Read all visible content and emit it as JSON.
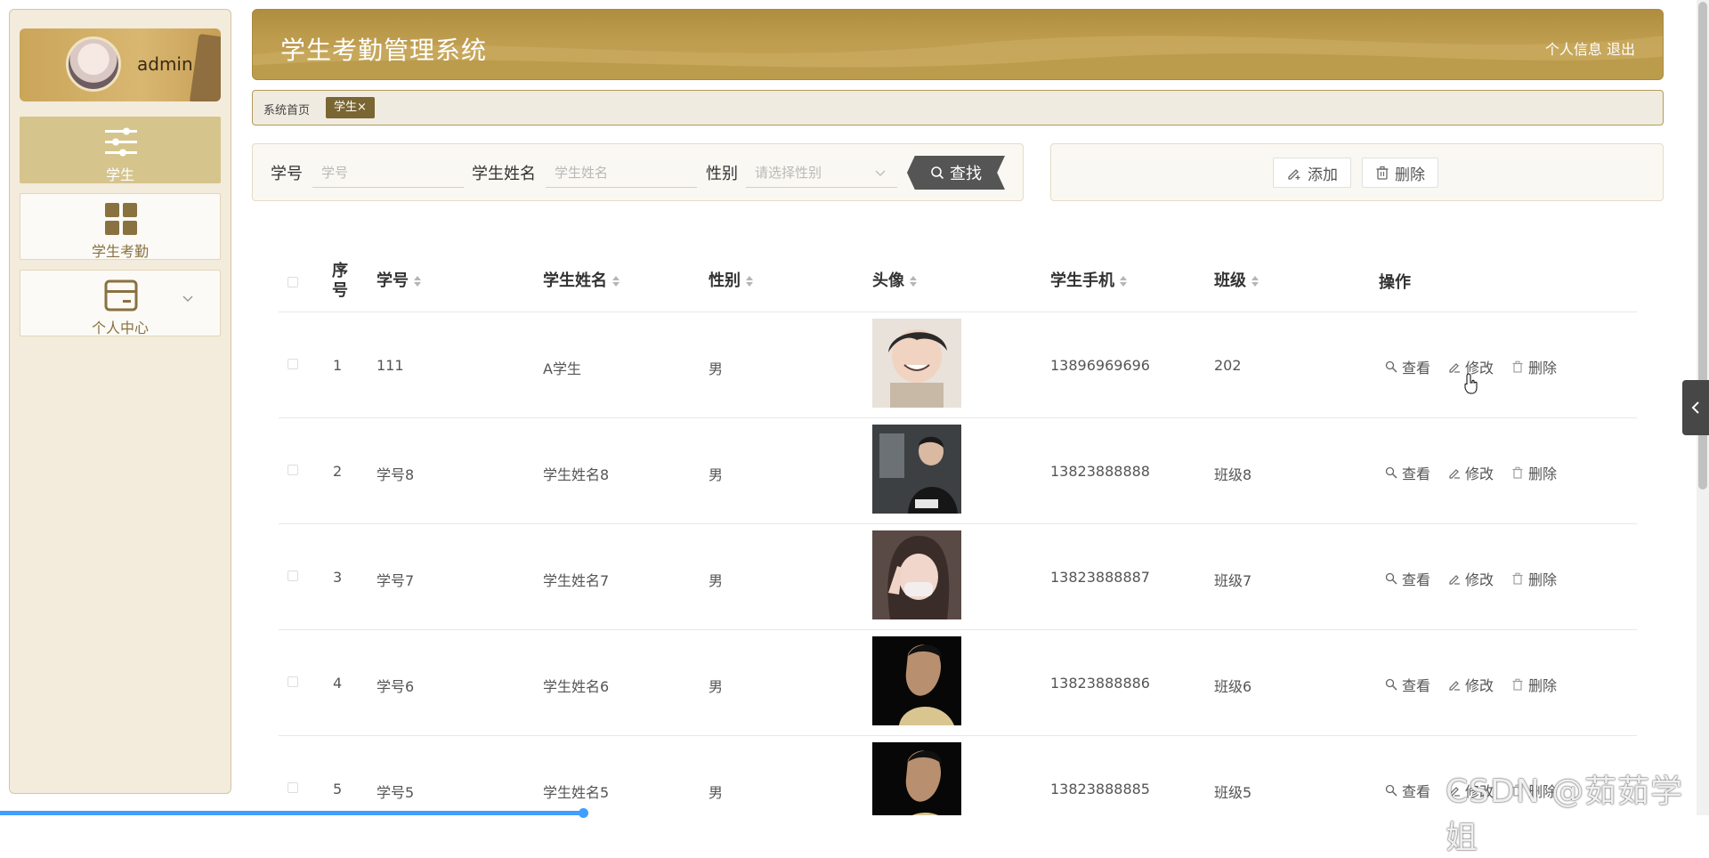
{
  "user": {
    "name": "admin"
  },
  "sidebar": {
    "items": [
      {
        "label": "学生",
        "icon": "sliders-icon",
        "active": true
      },
      {
        "label": "学生考勤",
        "icon": "grid-icon",
        "active": false
      },
      {
        "label": "个人中心",
        "icon": "card-icon",
        "active": false
      }
    ]
  },
  "header": {
    "title": "学生考勤管理系统",
    "links": {
      "profile": "个人信息",
      "logout": "退出"
    }
  },
  "breadcrumb": {
    "home": "系统首页",
    "tag": "学生×"
  },
  "search": {
    "student_id_label": "学号",
    "student_id_placeholder": "学号",
    "name_label": "学生姓名",
    "name_placeholder": "学生姓名",
    "gender_label": "性别",
    "gender_placeholder": "请选择性别",
    "search_button": "查找"
  },
  "actions": {
    "add": "添加",
    "delete": "删除"
  },
  "table": {
    "headers": {
      "index": "序号",
      "student_id": "学号",
      "name": "学生姓名",
      "gender": "性别",
      "avatar": "头像",
      "phone": "学生手机",
      "class": "班级",
      "ops": "操作"
    },
    "op_labels": {
      "view": "查看",
      "edit": "修改",
      "delete": "删除"
    },
    "rows": [
      {
        "index": "1",
        "student_id": "111",
        "name": "A学生",
        "gender": "男",
        "phone": "13896969696",
        "class": "202"
      },
      {
        "index": "2",
        "student_id": "学号8",
        "name": "学生姓名8",
        "gender": "男",
        "phone": "13823888888",
        "class": "班级8"
      },
      {
        "index": "3",
        "student_id": "学号7",
        "name": "学生姓名7",
        "gender": "男",
        "phone": "13823888887",
        "class": "班级7"
      },
      {
        "index": "4",
        "student_id": "学号6",
        "name": "学生姓名6",
        "gender": "男",
        "phone": "13823888886",
        "class": "班级6"
      },
      {
        "index": "5",
        "student_id": "学号5",
        "name": "学生姓名5",
        "gender": "男",
        "phone": "13823888885",
        "class": "班级5"
      }
    ]
  },
  "watermark": "CSDN @茹茹学姐",
  "colors": {
    "accent": "#b08d3e",
    "sidebar_bg": "#f3ebdc",
    "active_nav": "#d6c48d",
    "tag": "#7a6632"
  }
}
